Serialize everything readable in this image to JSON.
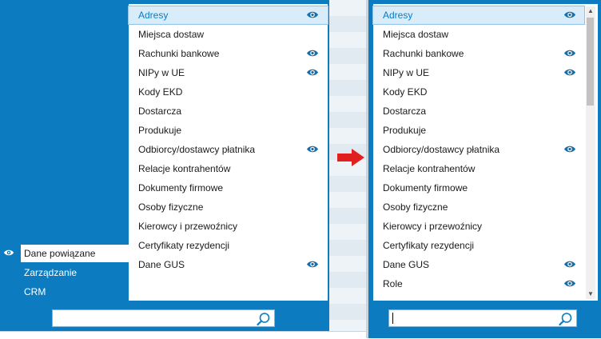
{
  "left": {
    "nav": [
      {
        "label": "Dane powiązane",
        "active": true
      },
      {
        "label": "Zarządzanie",
        "active": false
      },
      {
        "label": "CRM",
        "active": false
      }
    ],
    "list": [
      {
        "label": "Adresy",
        "eye": true,
        "selected": true
      },
      {
        "label": "Miejsca dostaw",
        "eye": false
      },
      {
        "label": "Rachunki bankowe",
        "eye": true
      },
      {
        "label": "NIPy w UE",
        "eye": true
      },
      {
        "label": "Kody EKD",
        "eye": false
      },
      {
        "label": "Dostarcza",
        "eye": false
      },
      {
        "label": "Produkuje",
        "eye": false
      },
      {
        "label": "Odbiorcy/dostawcy płatnika",
        "eye": true
      },
      {
        "label": "Relacje kontrahentów",
        "eye": false
      },
      {
        "label": "Dokumenty firmowe",
        "eye": false
      },
      {
        "label": "Osoby fizyczne",
        "eye": false
      },
      {
        "label": "Kierowcy i przewoźnicy",
        "eye": false
      },
      {
        "label": "Certyfikaty rezydencji",
        "eye": false
      },
      {
        "label": "Dane GUS",
        "eye": true
      }
    ],
    "search": {
      "value": "",
      "placeholder": ""
    }
  },
  "right": {
    "list": [
      {
        "label": "Adresy",
        "eye": true,
        "selected": true
      },
      {
        "label": "Miejsca dostaw",
        "eye": false
      },
      {
        "label": "Rachunki bankowe",
        "eye": true
      },
      {
        "label": "NIPy w UE",
        "eye": true
      },
      {
        "label": "Kody EKD",
        "eye": false
      },
      {
        "label": "Dostarcza",
        "eye": false
      },
      {
        "label": "Produkuje",
        "eye": false
      },
      {
        "label": "Odbiorcy/dostawcy płatnika",
        "eye": true
      },
      {
        "label": "Relacje kontrahentów",
        "eye": false
      },
      {
        "label": "Dokumenty firmowe",
        "eye": false
      },
      {
        "label": "Osoby fizyczne",
        "eye": false
      },
      {
        "label": "Kierowcy i przewoźnicy",
        "eye": false
      },
      {
        "label": "Certyfikaty rezydencji",
        "eye": false
      },
      {
        "label": "Dane GUS",
        "eye": true
      },
      {
        "label": "Role",
        "eye": true
      }
    ],
    "search": {
      "value": "",
      "placeholder": ""
    }
  },
  "colors": {
    "accent": "#0c7bc0",
    "arrow": "#e02020",
    "eye": "#1a6fa8"
  },
  "icons": {
    "eye": "eye-icon",
    "search": "search-icon",
    "arrow": "arrow-right-icon"
  }
}
